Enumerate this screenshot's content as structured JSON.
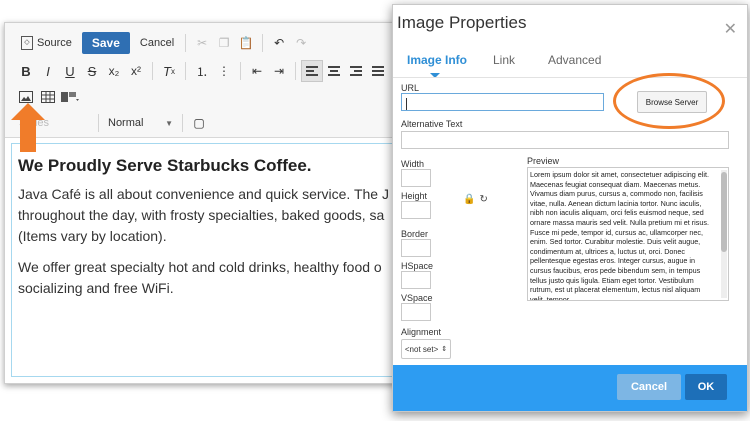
{
  "editor": {
    "toolbar": {
      "source_label": "Source",
      "save_label": "Save",
      "cancel_label": "Cancel",
      "superscript": "x²",
      "subscript": "x₂",
      "styles_placeholder": "Styles",
      "format_value": "Normal"
    },
    "content": {
      "heading": "We Proudly Serve Starbucks Coffee.",
      "paragraph1": "Java Café is all about convenience and quick service. The J\nthroughout the day, with frosty specialties, baked goods, sa\n(Items vary by location).",
      "paragraph2": "We offer great specialty hot and cold drinks, healthy food o\nsocializing and free WiFi."
    }
  },
  "dialog": {
    "title": "Image Properties",
    "tabs": [
      {
        "label": "Image Info",
        "active": true
      },
      {
        "label": "Link",
        "active": false
      },
      {
        "label": "Advanced",
        "active": false
      }
    ],
    "url_label": "URL",
    "url_value": "",
    "browse_button": "Browse Server",
    "alt_text_label": "Alternative Text",
    "width_label": "Width",
    "height_label": "Height",
    "border_label": "Border",
    "hspace_label": "HSpace",
    "vspace_label": "VSpace",
    "alignment_label": "Alignment",
    "alignment_value": "<not set>",
    "preview_label": "Preview",
    "preview_text": "Lorem ipsum dolor sit amet, consectetuer adipiscing elit. Maecenas feugiat consequat diam. Maecenas metus. Vivamus diam purus, cursus a, commodo non, facilisis vitae, nulla. Aenean dictum lacinia tortor. Nunc iaculis, nibh non iaculis aliquam, orci felis euismod neque, sed ornare massa mauris sed velit. Nulla pretium mi et risus. Fusce mi pede, tempor id, cursus ac, ullamcorper nec, enim. Sed tortor. Curabitur molestie. Duis velit augue, condimentum at, ultrices a, luctus ut, orci. Donec pellentesque egestas eros. Integer cursus, augue in cursus faucibus, eros pede bibendum sem, in tempus tellus justo quis ligula. Etiam eget tortor. Vestibulum rutrum, est ut placerat elementum, lectus nisl aliquam velit, tempor",
    "cancel_button": "Cancel",
    "ok_button": "OK"
  },
  "colors": {
    "accent_blue": "#2d9cf2",
    "ok_blue": "#1d6fb8",
    "annotation_orange": "#f07c2a"
  }
}
